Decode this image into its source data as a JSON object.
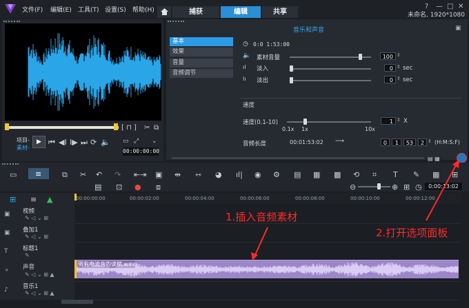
{
  "app": {
    "menu": [
      "文件(F)",
      "编辑(E)",
      "工具(T)",
      "设置(S)",
      "帮助(H)"
    ],
    "tabs": {
      "capture": "捕获",
      "edit": "编辑",
      "share": "共享"
    },
    "project_info": "未命名, 1920*1080"
  },
  "preview": {
    "mode_labels": {
      "project": "项目-",
      "clip": "素材-"
    },
    "timecode": "00:00:00:00"
  },
  "options_panel": {
    "title": "音乐和声音",
    "tabs": [
      "基本",
      "效果",
      "音量",
      "音频调节"
    ],
    "active_tab": "基本",
    "duration": "0:0 1:53:00",
    "clip_volume_label": "素材音量",
    "clip_volume_value": "100",
    "fade_in_label": "淡入",
    "fade_in_value": "0",
    "fade_in_unit": "sec",
    "fade_out_label": "淡出",
    "fade_out_value": "0",
    "fade_out_unit": "sec",
    "speed_section": "速度",
    "speed_label": "速度(0.1-10)",
    "speed_value": "1",
    "speed_unit": "X",
    "speed_marks": [
      "0.1x",
      "1x",
      "10x"
    ],
    "audio_length_label": "音频长度",
    "audio_length_value": "00:01:53:02",
    "length_fields": [
      "0",
      "1",
      "53",
      "2"
    ],
    "length_format": "(H:M:S:F)"
  },
  "timeline": {
    "ruler": [
      "00:00:00:00",
      "00:00:02:00",
      "00:00:04:00",
      "00:00:06:00",
      "00:00:08:00",
      "00:00:10:00",
      "00:00:12:00"
    ],
    "zoom_timecode": "0:00:13:02",
    "tracks": [
      "视频",
      "叠加1",
      "标题1",
      "声音",
      "音乐1"
    ],
    "audio_clip_label": "带有电流音的读稿.wav"
  },
  "annotations": {
    "insert_audio": "1.插入音频素材",
    "open_options": "2.打开选项面板"
  },
  "colors": {
    "accent": "#2a8fd6",
    "audio_clip": "#9c86c9",
    "annotation": "#ff2a2a",
    "waveform": "#2aa5e8"
  }
}
